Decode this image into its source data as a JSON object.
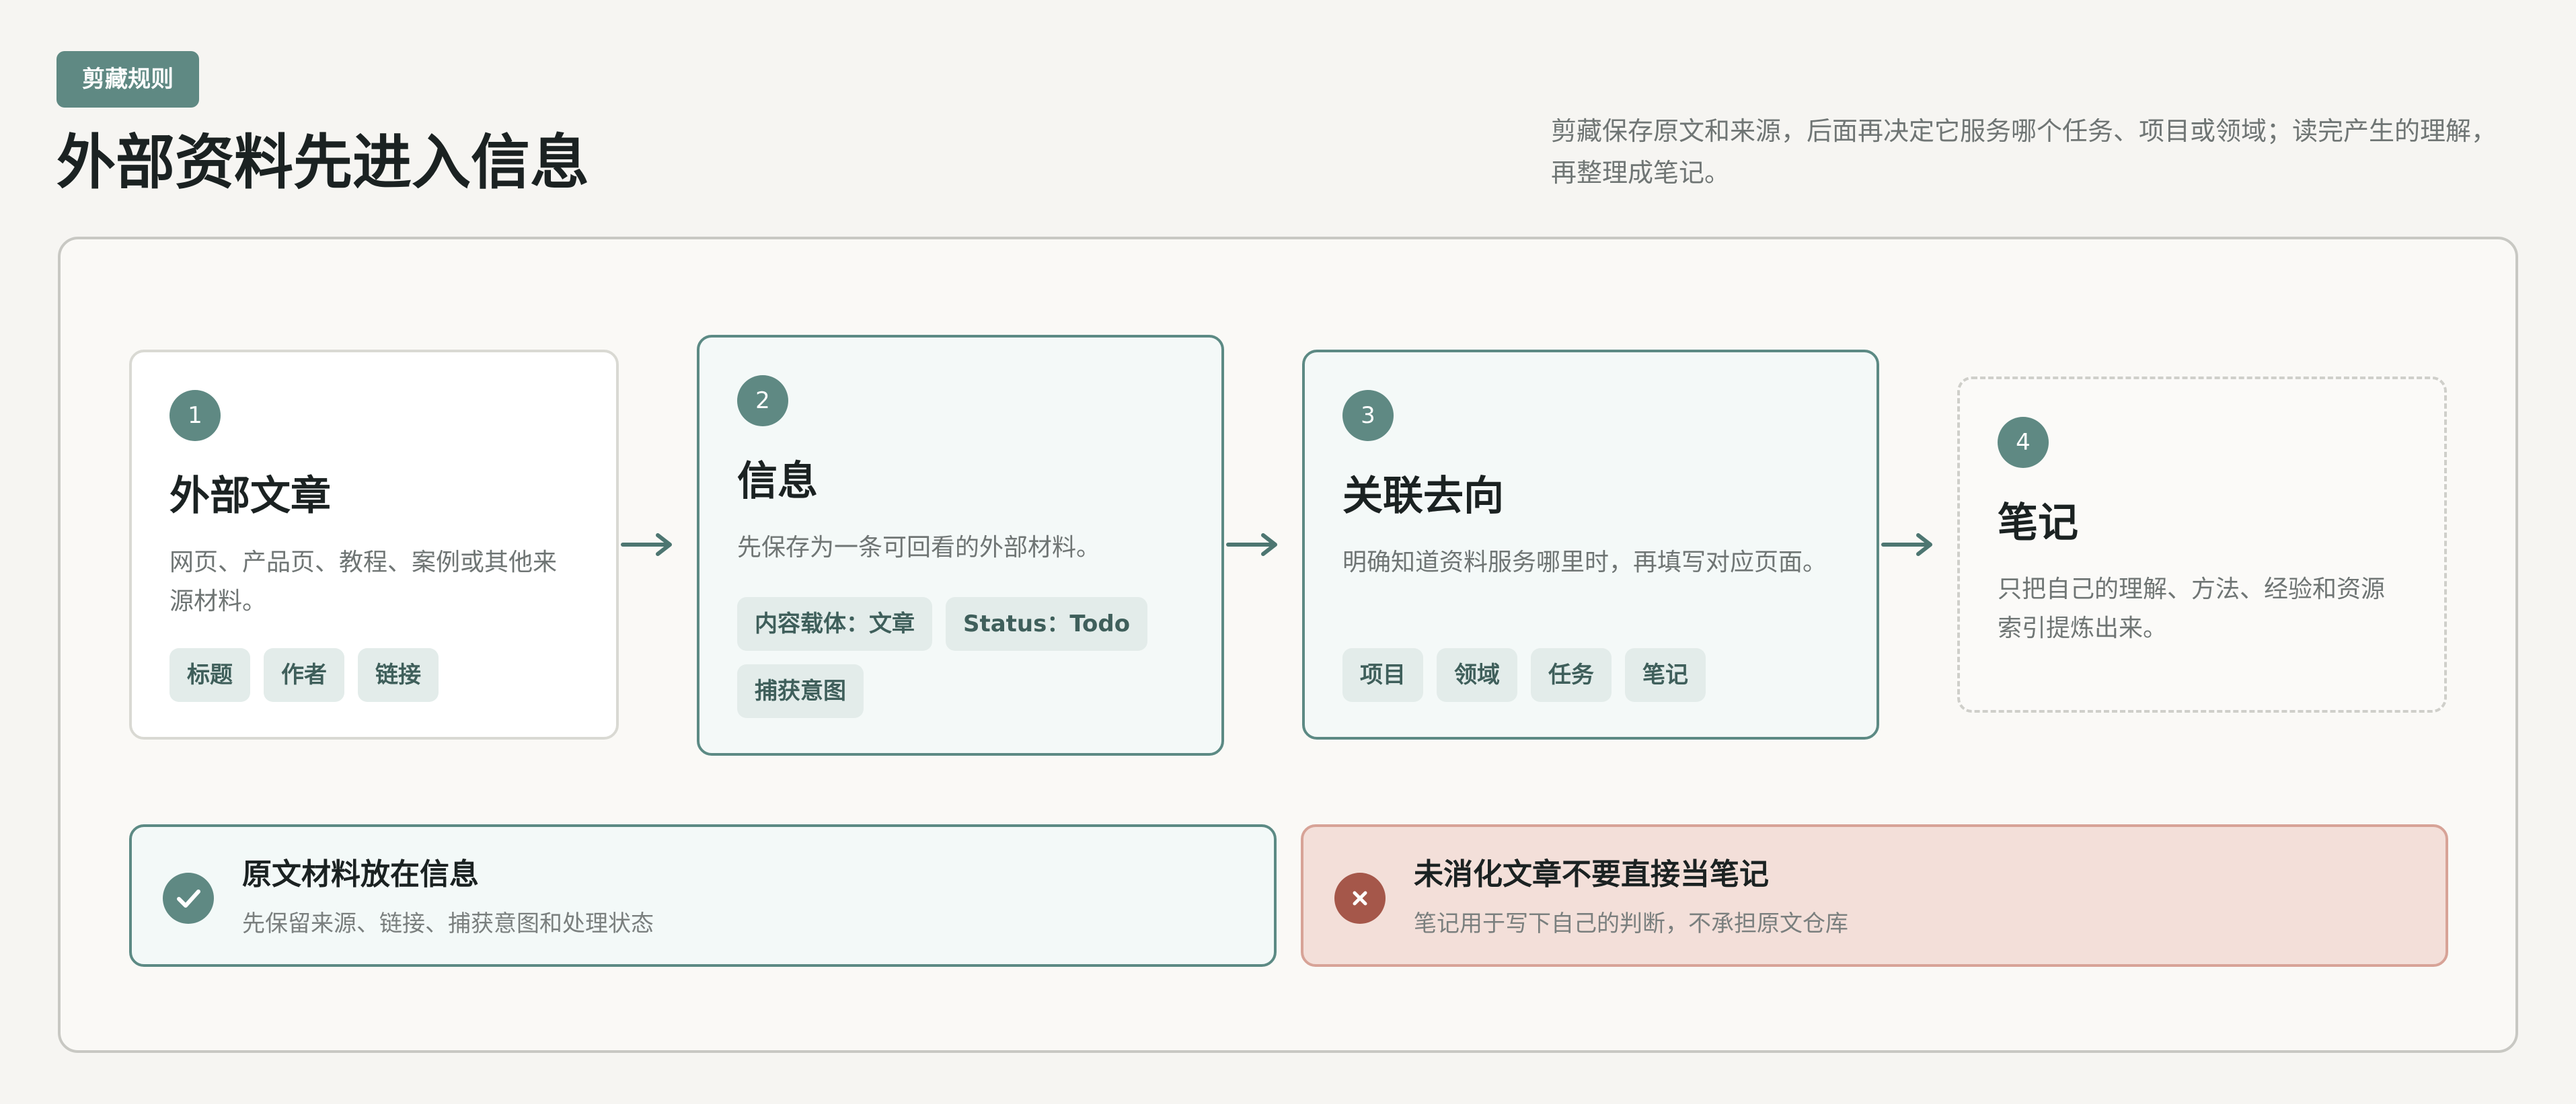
{
  "header": {
    "badge": "剪藏规则",
    "title": "外部资料先进入信息",
    "description": "剪藏保存原文和来源，后面再决定它服务哪个任务、项目或领域；读完产生的理解，再整理成笔记。"
  },
  "steps": [
    {
      "number": "1",
      "title": "外部文章",
      "description": "网页、产品页、教程、案例或其他来源材料。",
      "tags": [
        "标题",
        "作者",
        "链接"
      ]
    },
    {
      "number": "2",
      "title": "信息",
      "description": "先保存为一条可回看的外部材料。",
      "tags": [
        "内容载体：文章",
        "Status：Todo",
        "捕获意图"
      ]
    },
    {
      "number": "3",
      "title": "关联去向",
      "description": "明确知道资料服务哪里时，再填写对应页面。",
      "tags": [
        "项目",
        "领域",
        "任务",
        "笔记"
      ]
    },
    {
      "number": "4",
      "title": "笔记",
      "description": "只把自己的理解、方法、经验和资源索引提炼出来。",
      "tags": []
    }
  ],
  "callouts": {
    "good": {
      "title": "原文材料放在信息",
      "subtitle": "先保留来源、链接、捕获意图和处理状态"
    },
    "bad": {
      "title": "未消化文章不要直接当笔记",
      "subtitle": "笔记用于写下自己的判断，不承担原文仓库"
    }
  },
  "colors": {
    "accent": "#5f8983",
    "warning": "#a5574a",
    "tag_bg": "#e3ecea",
    "background": "#f6f5f2"
  }
}
